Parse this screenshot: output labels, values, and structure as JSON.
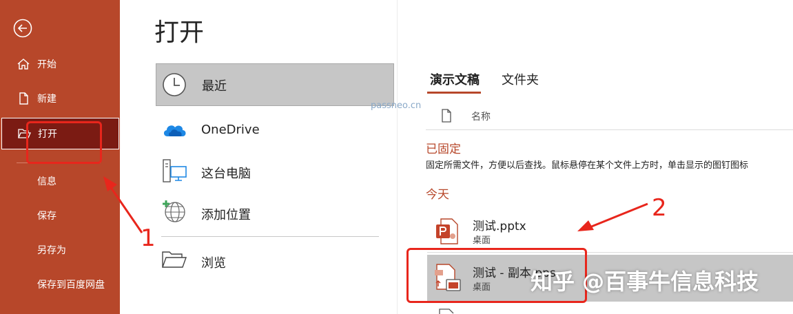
{
  "sidebar": {
    "back_icon": "back-arrow-icon",
    "items": [
      {
        "label": "开始",
        "icon": "home-icon"
      },
      {
        "label": "新建",
        "icon": "new-doc-icon"
      },
      {
        "label": "打开",
        "icon": "folder-open-icon",
        "active": true
      },
      {
        "label": "信息"
      },
      {
        "label": "保存"
      },
      {
        "label": "另存为"
      },
      {
        "label": "保存到百度网盘"
      }
    ]
  },
  "main": {
    "title": "打开",
    "locations": [
      {
        "label": "最近",
        "icon": "clock-icon",
        "selected": true
      },
      {
        "label": "OneDrive",
        "icon": "cloud-icon"
      },
      {
        "label": "这台电脑",
        "icon": "computer-icon"
      },
      {
        "label": "添加位置",
        "icon": "add-place-icon"
      },
      {
        "label": "浏览",
        "icon": "folder-icon"
      }
    ]
  },
  "files": {
    "tabs": [
      {
        "label": "演示文稿",
        "active": true
      },
      {
        "label": "文件夹"
      }
    ],
    "watermark": "passneo.cn",
    "column_name": "名称",
    "pinned": {
      "title": "已固定",
      "description": "固定所需文件，方便以后查找。鼠标悬停在某个文件上方时，单击显示的图钉图标"
    },
    "today": {
      "title": "今天",
      "items": [
        {
          "name": "测试.pptx",
          "location": "桌面",
          "icon": "pptx-file-icon"
        },
        {
          "name": "测试 - 副本.pps",
          "location": "桌面",
          "icon": "pps-file-icon",
          "selected": true
        }
      ]
    }
  },
  "annotations": {
    "label_1": "1",
    "label_2": "2",
    "watermark_zhihu": "知乎 @百事牛信息科技"
  },
  "colors": {
    "accent": "#b7472a",
    "sidebar_active": "#7b1b13",
    "annotation_red": "#e8261c",
    "selected_bg": "#c6c6c6"
  }
}
